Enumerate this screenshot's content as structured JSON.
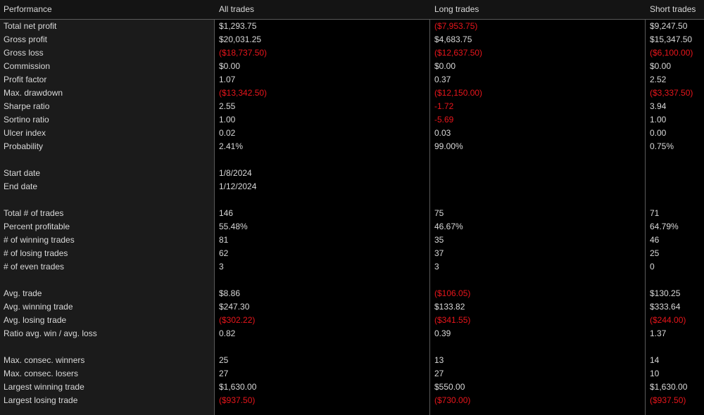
{
  "columns": [
    "Performance",
    "All trades",
    "Long trades",
    "Short trades"
  ],
  "rows": [
    {
      "label": "Total net profit",
      "all": "$1,293.75",
      "long": "($7,953.75)",
      "short": "$9,247.50"
    },
    {
      "label": "Gross profit",
      "all": "$20,031.25",
      "long": "$4,683.75",
      "short": "$15,347.50"
    },
    {
      "label": "Gross loss",
      "all": "($18,737.50)",
      "long": "($12,637.50)",
      "short": "($6,100.00)"
    },
    {
      "label": "Commission",
      "all": "$0.00",
      "long": "$0.00",
      "short": "$0.00"
    },
    {
      "label": "Profit factor",
      "all": "1.07",
      "long": "0.37",
      "short": "2.52"
    },
    {
      "label": "Max. drawdown",
      "all": "($13,342.50)",
      "long": "($12,150.00)",
      "short": "($3,337.50)"
    },
    {
      "label": "Sharpe ratio",
      "all": "2.55",
      "long": "-1.72",
      "short": "3.94"
    },
    {
      "label": "Sortino ratio",
      "all": "1.00",
      "long": "-5.69",
      "short": "1.00"
    },
    {
      "label": "Ulcer index",
      "all": "0.02",
      "long": "0.03",
      "short": "0.00"
    },
    {
      "label": "Probability",
      "all": "2.41%",
      "long": "99.00%",
      "short": "0.75%"
    },
    {
      "label": "",
      "all": "",
      "long": "",
      "short": ""
    },
    {
      "label": "Start date",
      "all": "1/8/2024",
      "long": "",
      "short": ""
    },
    {
      "label": "End date",
      "all": "1/12/2024",
      "long": "",
      "short": ""
    },
    {
      "label": "",
      "all": "",
      "long": "",
      "short": ""
    },
    {
      "label": "Total # of trades",
      "all": "146",
      "long": "75",
      "short": "71"
    },
    {
      "label": "Percent profitable",
      "all": "55.48%",
      "long": "46.67%",
      "short": "64.79%"
    },
    {
      "label": "# of winning trades",
      "all": "81",
      "long": "35",
      "short": "46"
    },
    {
      "label": "# of losing trades",
      "all": "62",
      "long": "37",
      "short": "25"
    },
    {
      "label": "# of even trades",
      "all": "3",
      "long": "3",
      "short": "0"
    },
    {
      "label": "",
      "all": "",
      "long": "",
      "short": ""
    },
    {
      "label": "Avg. trade",
      "all": "$8.86",
      "long": "($106.05)",
      "short": "$130.25"
    },
    {
      "label": "Avg. winning trade",
      "all": "$247.30",
      "long": "$133.82",
      "short": "$333.64"
    },
    {
      "label": "Avg. losing trade",
      "all": "($302.22)",
      "long": "($341.55)",
      "short": "($244.00)"
    },
    {
      "label": "Ratio avg. win / avg. loss",
      "all": "0.82",
      "long": "0.39",
      "short": "1.37"
    },
    {
      "label": "",
      "all": "",
      "long": "",
      "short": ""
    },
    {
      "label": "Max. consec. winners",
      "all": "25",
      "long": "13",
      "short": "14"
    },
    {
      "label": "Max. consec. losers",
      "all": "27",
      "long": "27",
      "short": "10"
    },
    {
      "label": "Largest winning trade",
      "all": "$1,630.00",
      "long": "$550.00",
      "short": "$1,630.00"
    },
    {
      "label": "Largest losing trade",
      "all": "($937.50)",
      "long": "($730.00)",
      "short": "($937.50)"
    }
  ],
  "colors": {
    "negative": "#e8151b",
    "text": "#d9d9d9",
    "label_column_bg": "#1b1b1b",
    "grid_line": "#5a5a5a"
  }
}
